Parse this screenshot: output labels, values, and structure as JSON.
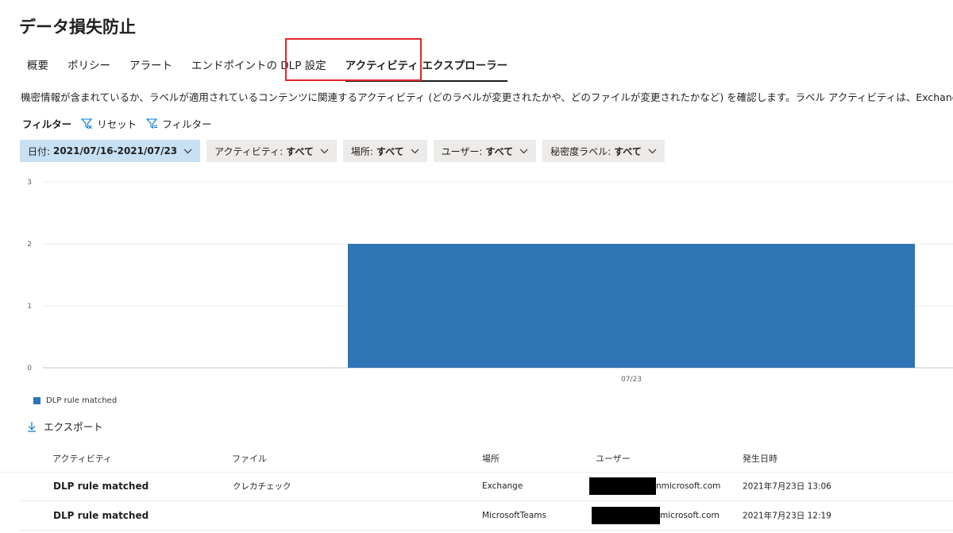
{
  "page": {
    "title": "データ損失防止"
  },
  "tabs": [
    {
      "label": "概要"
    },
    {
      "label": "ポリシー"
    },
    {
      "label": "アラート"
    },
    {
      "label": "エンドポイントの DLP 設定"
    },
    {
      "label": "アクティビティ エクスプローラー",
      "active": true
    }
  ],
  "description": "機密情報が含まれているか、ラベルが適用されているコンテンツに関連するアクティビティ (どのラベルが変更されたかや、どのファイルが変更されたかなど) を確認します。ラベル アクティビティは、Exchange、SharePoint、OneDrive、エンドポイント デバイスで",
  "filterbar": {
    "label": "フィルター",
    "reset": "リセット",
    "filter": "フィルター"
  },
  "chips": [
    {
      "key": "日付:",
      "value": "2021/07/16-2021/07/23",
      "active": true
    },
    {
      "key": "アクティビティ:",
      "value": "すべて"
    },
    {
      "key": "場所:",
      "value": "すべて"
    },
    {
      "key": "ユーザー:",
      "value": "すべて"
    },
    {
      "key": "秘密度ラベル:",
      "value": "すべて"
    }
  ],
  "chart_data": {
    "type": "bar",
    "categories": [
      "07/23"
    ],
    "series": [
      {
        "name": "DLP rule matched",
        "values": [
          2
        ],
        "color": "#2e75b6"
      }
    ],
    "ylim": [
      0,
      3
    ],
    "yticks": [
      "0",
      "1",
      "2",
      "3"
    ],
    "grid": true,
    "legend": "bottom-left"
  },
  "export": {
    "label": "エクスポート"
  },
  "table": {
    "headers": [
      "アクティビティ",
      "ファイル",
      "場所",
      "ユーザー",
      "発生日時"
    ],
    "rows": [
      {
        "activity": "DLP rule matched",
        "file": "クレカチェック",
        "location": "Exchange",
        "user": "nmicrosoft.com",
        "datetime": "2021年7月23日 13:06"
      },
      {
        "activity": "DLP rule matched",
        "file": "",
        "location": "MicrosoftTeams",
        "user": "microsoft.com",
        "datetime": "2021年7月23日 12:19"
      }
    ]
  }
}
